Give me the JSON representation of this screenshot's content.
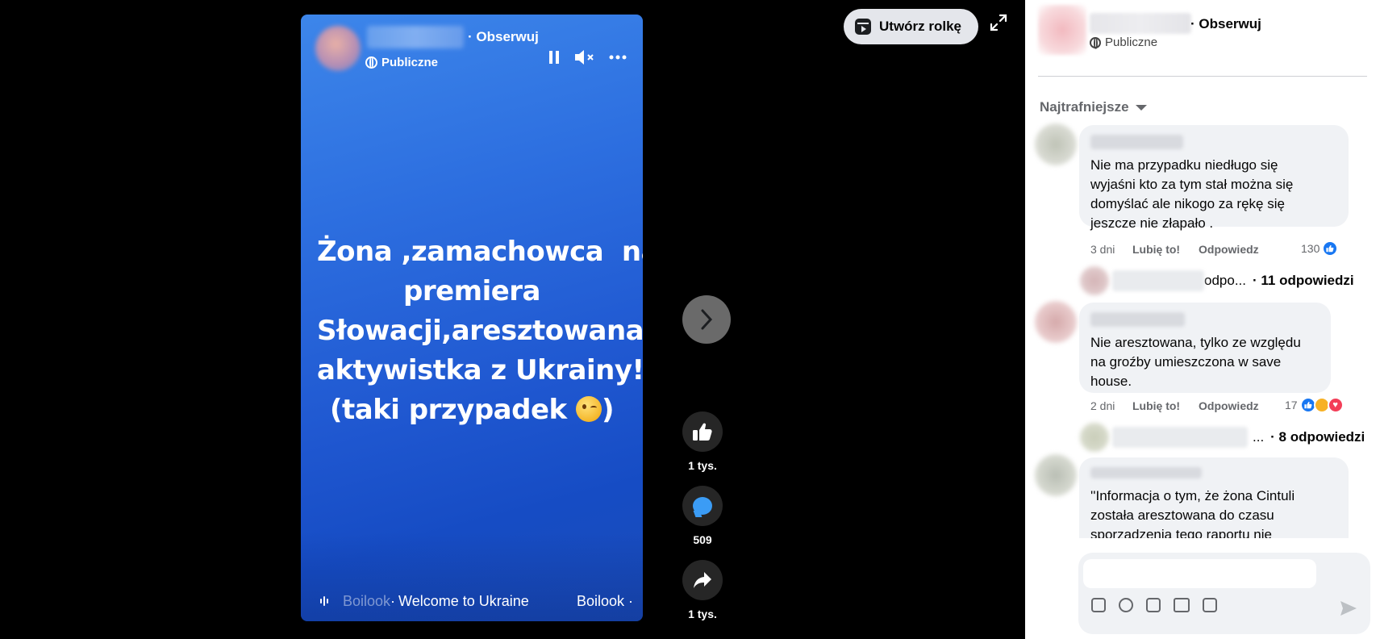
{
  "video": {
    "follow_label": "· Obserwuj",
    "audience": "Publiczne",
    "text_lines": [
      "Żona ,zamachowca  na",
      "premiera",
      "Słowacji,aresztowana.To",
      "aktywistka z Ukrainy!",
      "(taki przypadek "
    ],
    "music": {
      "author": "Boilook",
      "sep": " · ",
      "track": "Welcome to Ukraine",
      "author_repeat": "Boilook ·"
    },
    "icons": [
      "pause-icon",
      "mute-icon",
      "more-icon",
      "wink-emoji"
    ]
  },
  "actions": {
    "likes": "1 tys.",
    "comments": "509",
    "shares": "1 tys."
  },
  "toolbar": {
    "create_reel_label": "Utwórz rolkę"
  },
  "panel": {
    "follow_label": "· Obserwuj",
    "audience": "Publiczne",
    "sort_label": "Najtrafniejsze",
    "comments": [
      {
        "text": "Nie ma przypadku niedługo się\nwyjaśni kto za tym stał można się\ndomyślać ale nikogo za rękę się\njeszcze nie złapało .",
        "time": "3 dni",
        "like_label": "Lubię to!",
        "reply_label": "Odpowiedz",
        "reaction_count": "130",
        "replies_preview": "odpo...",
        "replies_summary": "· 11 odpowiedzi"
      },
      {
        "text": "Nie aresztowana, tylko ze względu\nna groźby umieszczona w save\nhouse.",
        "time": "2 dni",
        "like_label": "Lubię to!",
        "reply_label": "Odpowiedz",
        "reaction_count": "17",
        "replies_preview": "...",
        "replies_summary": "· 8 odpowiedzi"
      },
      {
        "text": "''Informacja o tym, że żona Cintuli\nzostała aresztowana do czasu\nsporządzenia tego raportu nie"
      }
    ],
    "composer": {
      "placeholder": ""
    }
  },
  "colors": {
    "video_blue": "#2d6fe0",
    "like_blue": "#1877f2",
    "love_red": "#f33e58",
    "haha_yellow": "#f7b125",
    "comment_blue": "#3b9cf5"
  }
}
